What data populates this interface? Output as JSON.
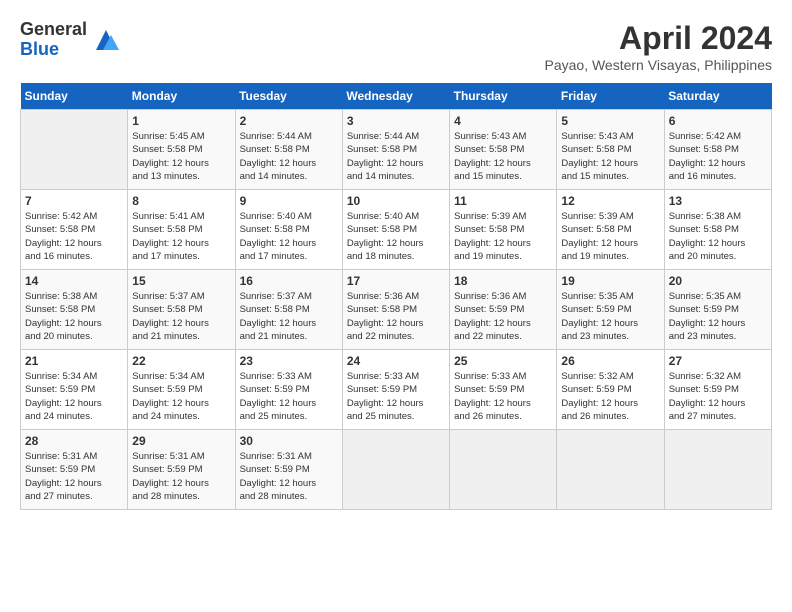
{
  "logo": {
    "general": "General",
    "blue": "Blue"
  },
  "title": "April 2024",
  "location": "Payao, Western Visayas, Philippines",
  "days_header": [
    "Sunday",
    "Monday",
    "Tuesday",
    "Wednesday",
    "Thursday",
    "Friday",
    "Saturday"
  ],
  "weeks": [
    [
      {
        "day": "",
        "info": ""
      },
      {
        "day": "1",
        "info": "Sunrise: 5:45 AM\nSunset: 5:58 PM\nDaylight: 12 hours\nand 13 minutes."
      },
      {
        "day": "2",
        "info": "Sunrise: 5:44 AM\nSunset: 5:58 PM\nDaylight: 12 hours\nand 14 minutes."
      },
      {
        "day": "3",
        "info": "Sunrise: 5:44 AM\nSunset: 5:58 PM\nDaylight: 12 hours\nand 14 minutes."
      },
      {
        "day": "4",
        "info": "Sunrise: 5:43 AM\nSunset: 5:58 PM\nDaylight: 12 hours\nand 15 minutes."
      },
      {
        "day": "5",
        "info": "Sunrise: 5:43 AM\nSunset: 5:58 PM\nDaylight: 12 hours\nand 15 minutes."
      },
      {
        "day": "6",
        "info": "Sunrise: 5:42 AM\nSunset: 5:58 PM\nDaylight: 12 hours\nand 16 minutes."
      }
    ],
    [
      {
        "day": "7",
        "info": "Sunrise: 5:42 AM\nSunset: 5:58 PM\nDaylight: 12 hours\nand 16 minutes."
      },
      {
        "day": "8",
        "info": "Sunrise: 5:41 AM\nSunset: 5:58 PM\nDaylight: 12 hours\nand 17 minutes."
      },
      {
        "day": "9",
        "info": "Sunrise: 5:40 AM\nSunset: 5:58 PM\nDaylight: 12 hours\nand 17 minutes."
      },
      {
        "day": "10",
        "info": "Sunrise: 5:40 AM\nSunset: 5:58 PM\nDaylight: 12 hours\nand 18 minutes."
      },
      {
        "day": "11",
        "info": "Sunrise: 5:39 AM\nSunset: 5:58 PM\nDaylight: 12 hours\nand 19 minutes."
      },
      {
        "day": "12",
        "info": "Sunrise: 5:39 AM\nSunset: 5:58 PM\nDaylight: 12 hours\nand 19 minutes."
      },
      {
        "day": "13",
        "info": "Sunrise: 5:38 AM\nSunset: 5:58 PM\nDaylight: 12 hours\nand 20 minutes."
      }
    ],
    [
      {
        "day": "14",
        "info": "Sunrise: 5:38 AM\nSunset: 5:58 PM\nDaylight: 12 hours\nand 20 minutes."
      },
      {
        "day": "15",
        "info": "Sunrise: 5:37 AM\nSunset: 5:58 PM\nDaylight: 12 hours\nand 21 minutes."
      },
      {
        "day": "16",
        "info": "Sunrise: 5:37 AM\nSunset: 5:58 PM\nDaylight: 12 hours\nand 21 minutes."
      },
      {
        "day": "17",
        "info": "Sunrise: 5:36 AM\nSunset: 5:58 PM\nDaylight: 12 hours\nand 22 minutes."
      },
      {
        "day": "18",
        "info": "Sunrise: 5:36 AM\nSunset: 5:59 PM\nDaylight: 12 hours\nand 22 minutes."
      },
      {
        "day": "19",
        "info": "Sunrise: 5:35 AM\nSunset: 5:59 PM\nDaylight: 12 hours\nand 23 minutes."
      },
      {
        "day": "20",
        "info": "Sunrise: 5:35 AM\nSunset: 5:59 PM\nDaylight: 12 hours\nand 23 minutes."
      }
    ],
    [
      {
        "day": "21",
        "info": "Sunrise: 5:34 AM\nSunset: 5:59 PM\nDaylight: 12 hours\nand 24 minutes."
      },
      {
        "day": "22",
        "info": "Sunrise: 5:34 AM\nSunset: 5:59 PM\nDaylight: 12 hours\nand 24 minutes."
      },
      {
        "day": "23",
        "info": "Sunrise: 5:33 AM\nSunset: 5:59 PM\nDaylight: 12 hours\nand 25 minutes."
      },
      {
        "day": "24",
        "info": "Sunrise: 5:33 AM\nSunset: 5:59 PM\nDaylight: 12 hours\nand 25 minutes."
      },
      {
        "day": "25",
        "info": "Sunrise: 5:33 AM\nSunset: 5:59 PM\nDaylight: 12 hours\nand 26 minutes."
      },
      {
        "day": "26",
        "info": "Sunrise: 5:32 AM\nSunset: 5:59 PM\nDaylight: 12 hours\nand 26 minutes."
      },
      {
        "day": "27",
        "info": "Sunrise: 5:32 AM\nSunset: 5:59 PM\nDaylight: 12 hours\nand 27 minutes."
      }
    ],
    [
      {
        "day": "28",
        "info": "Sunrise: 5:31 AM\nSunset: 5:59 PM\nDaylight: 12 hours\nand 27 minutes."
      },
      {
        "day": "29",
        "info": "Sunrise: 5:31 AM\nSunset: 5:59 PM\nDaylight: 12 hours\nand 28 minutes."
      },
      {
        "day": "30",
        "info": "Sunrise: 5:31 AM\nSunset: 5:59 PM\nDaylight: 12 hours\nand 28 minutes."
      },
      {
        "day": "",
        "info": ""
      },
      {
        "day": "",
        "info": ""
      },
      {
        "day": "",
        "info": ""
      },
      {
        "day": "",
        "info": ""
      }
    ]
  ]
}
